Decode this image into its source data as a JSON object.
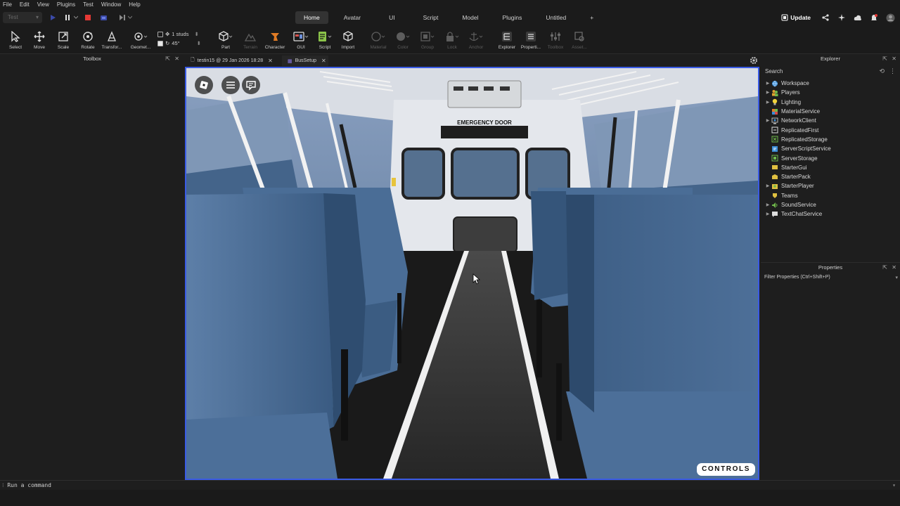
{
  "menu": [
    "File",
    "Edit",
    "View",
    "Plugins",
    "Test",
    "Window",
    "Help"
  ],
  "test_selector": "Test",
  "main_tabs": [
    {
      "label": "Home",
      "active": true
    },
    {
      "label": "Avatar"
    },
    {
      "label": "UI"
    },
    {
      "label": "Script"
    },
    {
      "label": "Model"
    },
    {
      "label": "Plugins"
    },
    {
      "label": "Untitled"
    },
    {
      "label": "+"
    }
  ],
  "update_label": "Update",
  "tools": {
    "select": "Select",
    "move": "Move",
    "scale": "Scale",
    "rotate": "Rotate",
    "transform": "Transfor...",
    "geometry": "Geomet...",
    "part": "Part",
    "terrain": "Terrain",
    "character": "Character",
    "gui": "GUI",
    "script": "Script",
    "import": "Import",
    "material": "Material",
    "color": "Color",
    "group": "Group",
    "lock": "Lock",
    "anchor": "Anchor",
    "explorer": "Explorer",
    "properties": "Properti...",
    "toolbox": "Toolbox",
    "asset": "Asset..."
  },
  "snap": {
    "studs": "1 studs",
    "angle": "45°"
  },
  "toolbox_title": "Toolbox",
  "doc_tabs": [
    {
      "label": "testin15 @ 29 Jan 2026 18:28",
      "active": false
    },
    {
      "label": "BusSetup",
      "active": true
    }
  ],
  "scene": {
    "emergency_door_text": "EMERGENCY DOOR",
    "controls_label": "CONTROLS"
  },
  "explorer": {
    "title": "Explorer",
    "search_placeholder": "Search",
    "items": [
      {
        "label": "Workspace",
        "icon": "globe-icon",
        "expandable": true
      },
      {
        "label": "Players",
        "icon": "players-icon",
        "expandable": true
      },
      {
        "label": "Lighting",
        "icon": "lightbulb-icon",
        "expandable": true
      },
      {
        "label": "MaterialService",
        "icon": "material-icon",
        "expandable": false
      },
      {
        "label": "NetworkClient",
        "icon": "network-icon",
        "expandable": true
      },
      {
        "label": "ReplicatedFirst",
        "icon": "replicated-first-icon",
        "expandable": false
      },
      {
        "label": "ReplicatedStorage",
        "icon": "replicated-storage-icon",
        "expandable": false
      },
      {
        "label": "ServerScriptService",
        "icon": "server-script-icon",
        "expandable": false
      },
      {
        "label": "ServerStorage",
        "icon": "server-storage-icon",
        "expandable": false
      },
      {
        "label": "StarterGui",
        "icon": "starter-gui-icon",
        "expandable": false
      },
      {
        "label": "StarterPack",
        "icon": "starter-pack-icon",
        "expandable": false
      },
      {
        "label": "StarterPlayer",
        "icon": "starter-player-icon",
        "expandable": true
      },
      {
        "label": "Teams",
        "icon": "teams-icon",
        "expandable": false
      },
      {
        "label": "SoundService",
        "icon": "sound-icon",
        "expandable": true
      },
      {
        "label": "TextChatService",
        "icon": "chat-icon",
        "expandable": true
      }
    ]
  },
  "properties": {
    "title": "Properties",
    "filter_placeholder": "Filter Properties (Ctrl+Shift+P)"
  },
  "command_bar": {
    "placeholder": "Run a command"
  },
  "colors": {
    "accent_blue": "#3a5be5",
    "stop_red": "#e53935",
    "seat_blue": "#3f6389"
  }
}
